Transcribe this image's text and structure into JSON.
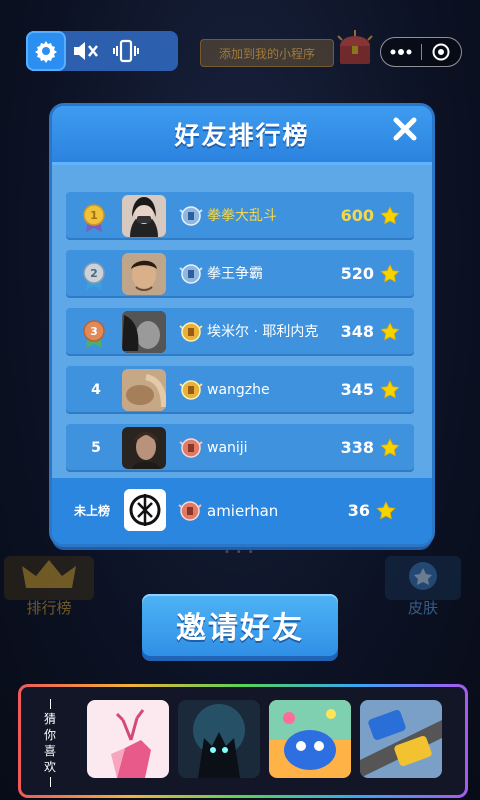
{
  "topbar": {
    "add_to_my_miniprogram": "添加到我的小程序"
  },
  "background_buttons": {
    "leaderboard": "排行榜",
    "skins": "皮肤"
  },
  "modal": {
    "title": "好友排行榜",
    "rows": [
      {
        "rank": "1",
        "name": "拳拳大乱斗",
        "score": "600",
        "highlight": "#f5d84a"
      },
      {
        "rank": "2",
        "name": "拳王争霸",
        "score": "520"
      },
      {
        "rank": "3",
        "name": "埃米尔 · 耶利内克",
        "score": "348"
      },
      {
        "rank": "4",
        "name": "wangzhe",
        "score": "345"
      },
      {
        "rank": "5",
        "name": "waniji",
        "score": "338"
      }
    ],
    "me": {
      "label": "未上榜",
      "name": "amierhan",
      "score": "36"
    }
  },
  "invite_button": "邀请好友",
  "guess_you_like": {
    "label_chars": [
      "猜",
      "你",
      "喜",
      "欢"
    ]
  },
  "colors": {
    "accent": "#2b86e0",
    "gold_text": "#f5d84a",
    "star": "#f5d400"
  }
}
